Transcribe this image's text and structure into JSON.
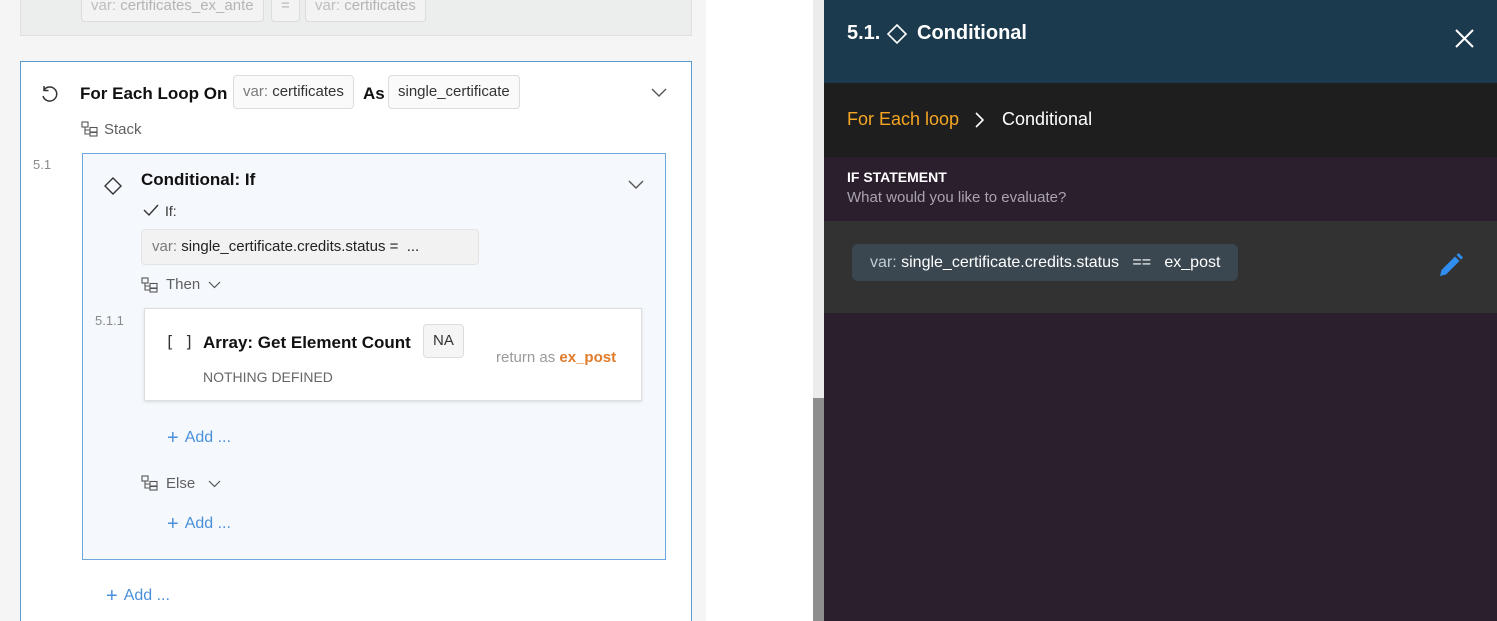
{
  "canvas": {
    "prev_step": {
      "var_prefix": "var:",
      "left_var": "certificates_ex_ante",
      "operator": "=",
      "right_var": "certificates"
    },
    "loop": {
      "title": "For Each Loop On",
      "var_prefix": "var:",
      "var_name": "certificates",
      "as_label": "As",
      "alias": "single_certificate",
      "stack_label": "Stack",
      "add_label": "Add ...",
      "conditional": {
        "step_number": "5.1",
        "title": "Conditional: If",
        "if_label": "If:",
        "expression_prefix": "var:",
        "expression": "single_certificate.credits.status =",
        "expression_ellipsis": "...",
        "then_label": "Then",
        "else_label": "Else",
        "then_add_label": "Add ...",
        "else_add_label": "Add ...",
        "array_step": {
          "step_number": "5.1.1",
          "title": "Array: Get Element Count",
          "badge": "NA",
          "subtitle": "NOTHING DEFINED",
          "return_as_label": "return as",
          "return_var": "ex_post"
        }
      }
    }
  },
  "panel": {
    "step_number": "5.1.",
    "title": "Conditional",
    "breadcrumb": {
      "parent": "For Each loop",
      "current": "Conditional"
    },
    "section_title": "IF STATEMENT",
    "section_subtitle": "What would you like to evaluate?",
    "expression": {
      "prefix": "var:",
      "variable": "single_certificate.credits.status",
      "operator": "==",
      "value": "ex_post"
    }
  },
  "colors": {
    "panel_header_bg": "#1c3a4d",
    "breadcrumb_accent": "#f5a623",
    "return_var_accent": "#e07b2a",
    "edit_icon": "#2f8ef0",
    "add_link": "#4a90d9",
    "card_border": "#5b9bd5"
  }
}
